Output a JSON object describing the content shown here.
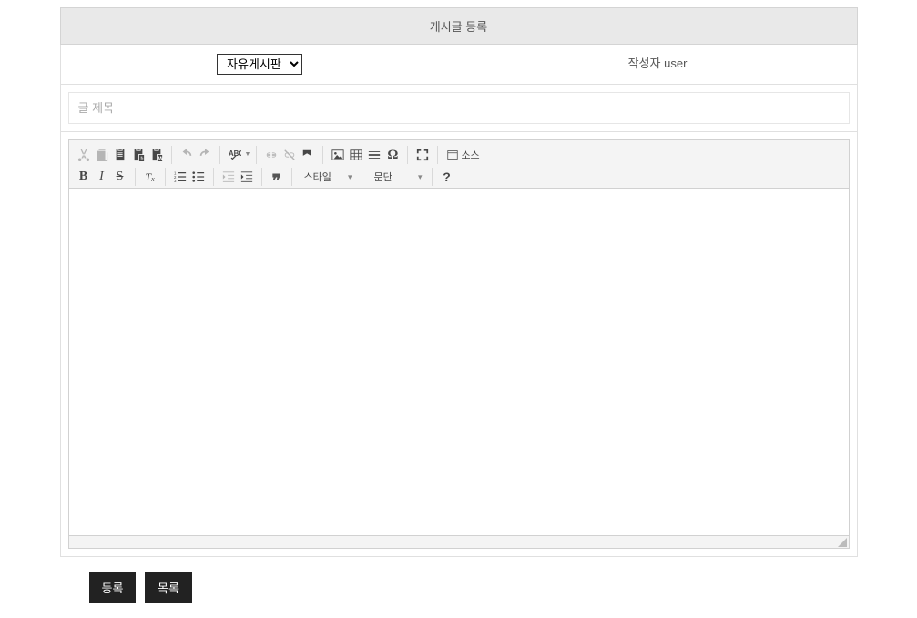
{
  "header": {
    "title": "게시글 등록"
  },
  "meta": {
    "board_select": {
      "selected": "자유게시판",
      "options": [
        "자유게시판"
      ]
    },
    "author_label": "작성자",
    "author_name": "user"
  },
  "title_field": {
    "placeholder": "글 제목",
    "value": ""
  },
  "editor": {
    "style_combo": "스타일",
    "format_combo": "문단",
    "source_btn": "소스",
    "bold": "B",
    "italic": "I",
    "strike": "S"
  },
  "buttons": {
    "submit": "등록",
    "list": "목록"
  }
}
